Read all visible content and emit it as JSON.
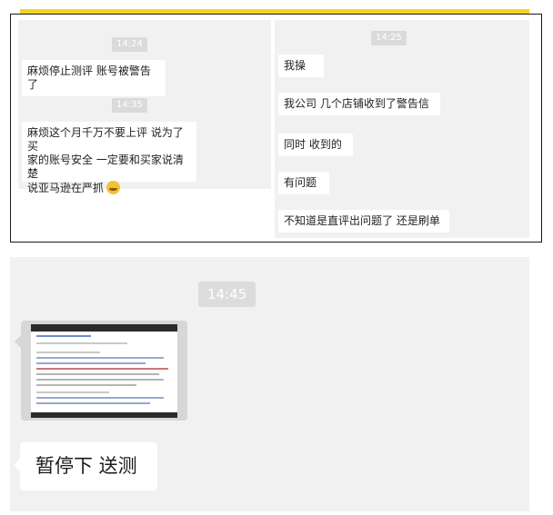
{
  "top_chat": {
    "left": {
      "time1": "14:24",
      "msg1": "麻烦停止测评 账号被警告了",
      "time2": "14:35",
      "msg2_l1": "麻烦这个月千万不要上评 说为了买",
      "msg2_l2": "家的账号安全 一定要和买家说清楚",
      "msg2_l3": "说亚马逊在严抓"
    },
    "right": {
      "time1": "14:25",
      "msg1": "我操",
      "msg2": "我公司 几个店铺收到了警告信",
      "msg3": "同时 收到的",
      "msg4": "有问题",
      "msg5": "不知道是直评出问题了 还是刷单"
    }
  },
  "bottom_chat": {
    "time": "14:45",
    "big_msg": "暂停下 送测"
  },
  "colors": {
    "accent": "#f5d21f",
    "chat_bg": "#f1f1f1",
    "bubble": "#ffffff"
  },
  "icons": {
    "emoji": "grinning-sweat-face-icon"
  }
}
